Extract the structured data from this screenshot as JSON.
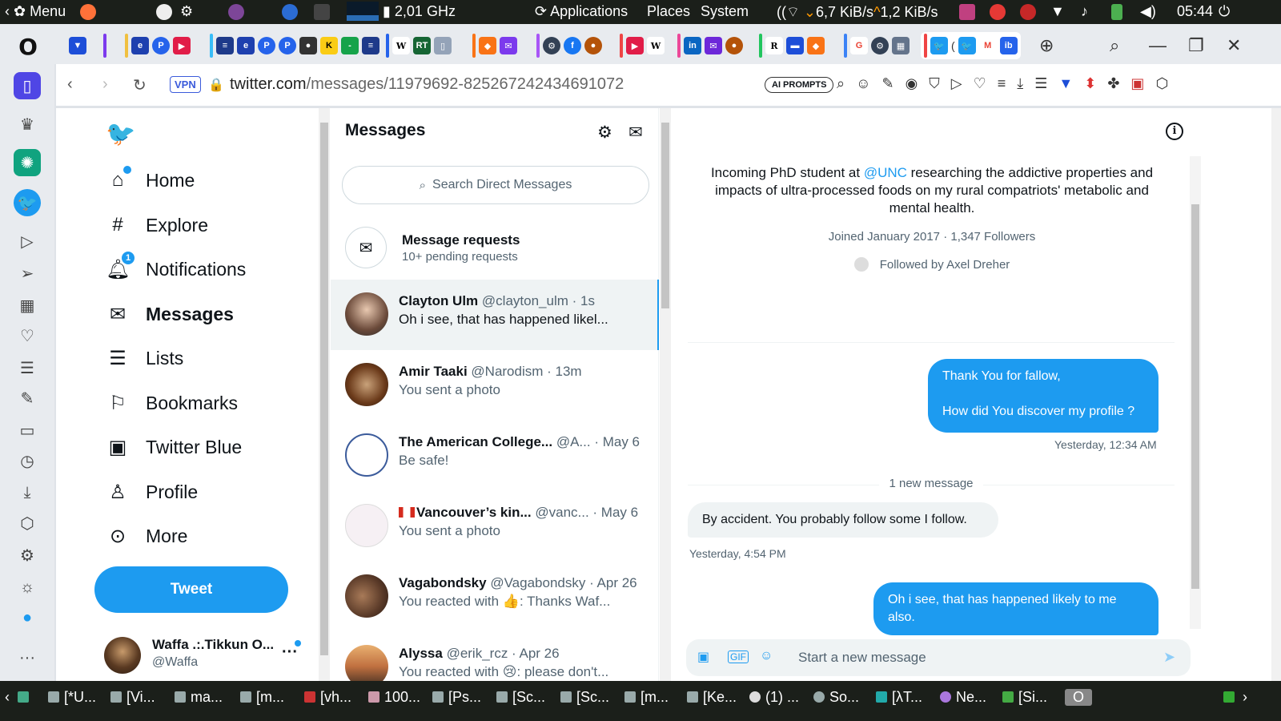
{
  "system_bar": {
    "menu": "Menu",
    "cpu": "2,01 GHz",
    "applications": "Applications",
    "places": "Places",
    "system": "System",
    "net_down": "6,7 KiB/s",
    "net_up": "1,2 KiB/s",
    "clock": "05:44"
  },
  "browser": {
    "url_host": "twitter.com",
    "url_path": "/messages/11979692-825267242434691072",
    "vpn": "VPN",
    "ai_prompts": "AI PROMPTS"
  },
  "nav": {
    "items": [
      {
        "label": "Home",
        "icon": "home-icon"
      },
      {
        "label": "Explore",
        "icon": "hashtag-icon"
      },
      {
        "label": "Notifications",
        "icon": "bell-icon",
        "badge": "1"
      },
      {
        "label": "Messages",
        "icon": "envelope-icon"
      },
      {
        "label": "Lists",
        "icon": "list-icon"
      },
      {
        "label": "Bookmarks",
        "icon": "bookmark-icon"
      },
      {
        "label": "Twitter Blue",
        "icon": "twitter-blue-icon"
      },
      {
        "label": "Profile",
        "icon": "person-icon"
      },
      {
        "label": "More",
        "icon": "more-circle-icon"
      }
    ],
    "tweet_button": "Tweet",
    "account": {
      "name": "Waffa .:.Tikkun O...",
      "handle": "@Waffa"
    }
  },
  "messages": {
    "title": "Messages",
    "search_placeholder": "Search Direct Messages",
    "requests": {
      "title": "Message requests",
      "subtitle": "10+ pending requests"
    },
    "conversations": [
      {
        "name": "Clayton Ulm",
        "meta": "@clayton_ulm · 1s",
        "preview": "Oh i see, that has happened likel..."
      },
      {
        "name": "Amir Taaki",
        "meta": "@Narodism · 13m",
        "preview": "You sent a photo"
      },
      {
        "name": "The American College...",
        "meta": "@A...   · May 6",
        "preview": "Be safe!"
      },
      {
        "name": "Vancouver’s kin...",
        "meta": "@vanc... · May 6",
        "preview": "You sent a photo"
      },
      {
        "name": "Vagabondsky",
        "meta": "@Vagabondsky · Apr 26",
        "preview": "You reacted with 👍: Thanks Waf..."
      },
      {
        "name": "Alyssa",
        "meta": "@erik_rcz · Apr 26",
        "preview": "You reacted with 😢: please don't..."
      }
    ]
  },
  "conversation": {
    "bio_pre": "Incoming PhD student at ",
    "bio_mention": "@UNC",
    "bio_post": " researching the addictive properties and impacts of ultra-processed foods on my rural compatriots' metabolic and mental health.",
    "joined": "Joined January 2017 · 1,347 Followers",
    "followed_by": "Followed by Axel Dreher",
    "msg1_line1": "Thank You for fallow,",
    "msg1_line2": "How did You discover my profile ?",
    "msg1_time": "Yesterday, 12:34 AM",
    "new_message": "1 new message",
    "msg2": "By accident. You probably follow some I follow.",
    "msg2_time": "Yesterday, 4:54 PM",
    "msg3": "Oh i see, that has happened likely to me also.",
    "composer_placeholder": "Start a new message"
  },
  "taskbar": {
    "items": [
      "[*U...",
      "[Vi...",
      "ma...",
      "[m...",
      "[vh...",
      "100...",
      "[Ps...",
      "[Sc...",
      "[Sc...",
      "[m...",
      "[Ke...",
      "(1) ...",
      "So...",
      "[λT...",
      "Ne...",
      "[Si..."
    ]
  }
}
